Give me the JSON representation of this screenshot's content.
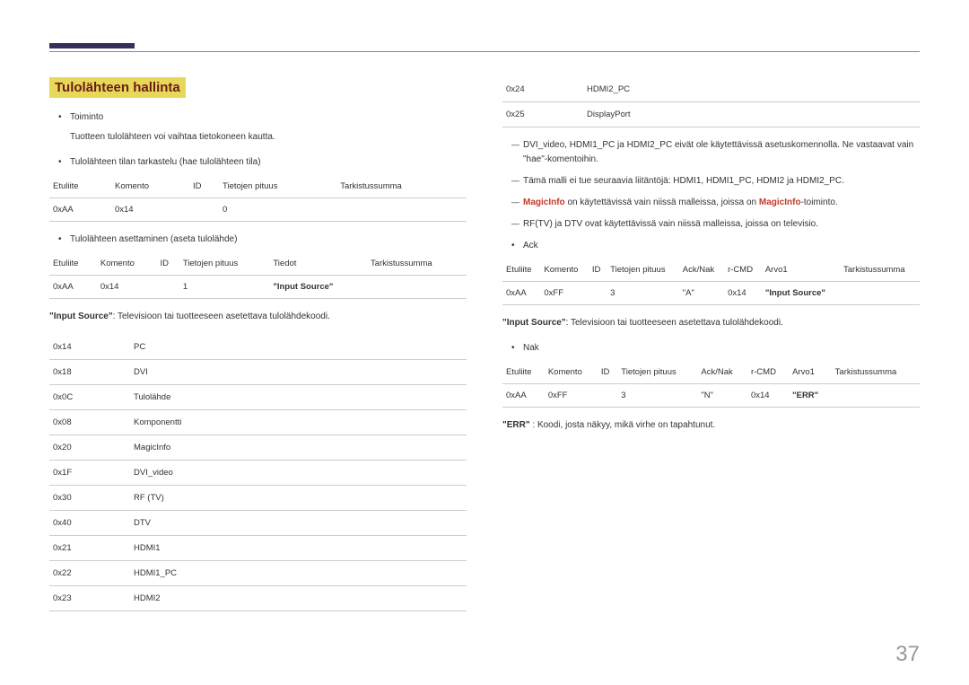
{
  "page_number": "37",
  "section_title": "Tulolähteen hallinta",
  "left": {
    "toiminto_label": "Toiminto",
    "toiminto_desc": "Tuotteen tulolähteen voi vaihtaa tietokoneen kautta.",
    "view_state_label": "Tulolähteen tilan tarkastelu (hae tulolähteen tila)",
    "table1": {
      "headers": [
        "Etuliite",
        "Komento",
        "ID",
        "Tietojen pituus",
        "Tarkistussumma"
      ],
      "row": [
        "0xAA",
        "0x14",
        "",
        "0",
        ""
      ]
    },
    "set_state_label": "Tulolähteen asettaminen (aseta tulolähde)",
    "table2": {
      "headers": [
        "Etuliite",
        "Komento",
        "ID",
        "Tietojen pituus",
        "Tiedot",
        "Tarkistussumma"
      ],
      "row": [
        "0xAA",
        "0x14",
        "",
        "1",
        "\"Input Source\"",
        ""
      ]
    },
    "input_source_note_prefix": "\"Input Source\"",
    "input_source_note_text": ": Televisioon tai tuotteeseen asetettava tulolähdekoodi.",
    "codes": [
      [
        "0x14",
        "PC"
      ],
      [
        "0x18",
        "DVI"
      ],
      [
        "0x0C",
        "Tulolähde"
      ],
      [
        "0x08",
        "Komponentti"
      ],
      [
        "0x20",
        "MagicInfo"
      ],
      [
        "0x1F",
        "DVI_video"
      ],
      [
        "0x30",
        "RF (TV)"
      ],
      [
        "0x40",
        "DTV"
      ],
      [
        "0x21",
        "HDMI1"
      ],
      [
        "0x22",
        "HDMI1_PC"
      ],
      [
        "0x23",
        "HDMI2"
      ]
    ]
  },
  "right": {
    "codes": [
      [
        "0x24",
        "HDMI2_PC"
      ],
      [
        "0x25",
        "DisplayPort"
      ]
    ],
    "dash1": "DVI_video, HDMI1_PC ja HDMI2_PC eivät ole käytettävissä asetuskomennolla. Ne vastaavat vain \"hae\"-komentoihin.",
    "dash2": "Tämä malli ei tue seuraavia liitäntöjä: HDMI1, HDMI1_PC, HDMI2 ja HDMI2_PC.",
    "dash3_pre": "MagicInfo",
    "dash3_mid": " on käytettävissä vain niissä malleissa, joissa on ",
    "dash3_mid2": "MagicInfo",
    "dash3_end": "-toiminto.",
    "dash4": "RF(TV) ja DTV ovat käytettävissä vain niissä malleissa, joissa on televisio.",
    "ack_label": "Ack",
    "ack_table": {
      "headers": [
        "Etuliite",
        "Komento",
        "ID",
        "Tietojen pituus",
        "Ack/Nak",
        "r-CMD",
        "Arvo1",
        "Tarkistussumma"
      ],
      "row": [
        "0xAA",
        "0xFF",
        "",
        "3",
        "\"A\"",
        "0x14",
        "\"Input Source\"",
        ""
      ]
    },
    "ack_note_prefix": "\"Input Source\"",
    "ack_note_text": ": Televisioon tai tuotteeseen asetettava tulolähdekoodi.",
    "nak_label": "Nak",
    "nak_table": {
      "headers": [
        "Etuliite",
        "Komento",
        "ID",
        "Tietojen pituus",
        "Ack/Nak",
        "r-CMD",
        "Arvo1",
        "Tarkistussumma"
      ],
      "row": [
        "0xAA",
        "0xFF",
        "",
        "3",
        "\"N\"",
        "0x14",
        "\"ERR\"",
        ""
      ]
    },
    "err_note_prefix": "\"ERR\"",
    "err_note_text": " : Koodi, josta näkyy, mikä virhe on tapahtunut."
  }
}
